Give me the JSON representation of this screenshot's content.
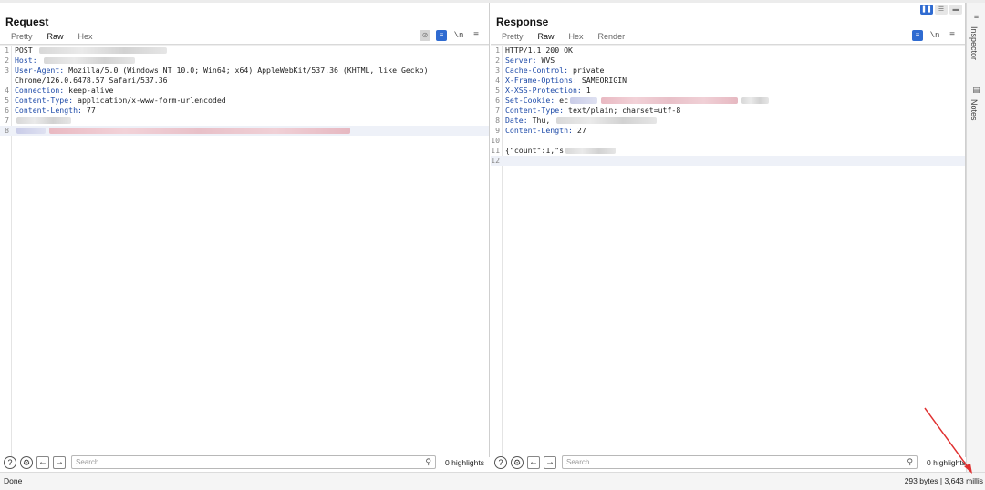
{
  "request": {
    "title": "Request",
    "tabs": [
      "Pretty",
      "Raw",
      "Hex"
    ],
    "active_tab": "Raw",
    "lines": [
      {
        "n": "1",
        "key": "",
        "val": "POST"
      },
      {
        "n": "2",
        "key": "Host:",
        "val": ""
      },
      {
        "n": "3",
        "key": "User-Agent:",
        "val": "Mozilla/5.0 (Windows NT 10.0; Win64; x64) AppleWebKit/537.36 (KHTML, like Gecko)"
      },
      {
        "n": "",
        "key": "",
        "val": "Chrome/126.0.6478.57 Safari/537.36"
      },
      {
        "n": "4",
        "key": "Connection:",
        "val": "keep-alive"
      },
      {
        "n": "5",
        "key": "Content-Type:",
        "val": "application/x-www-form-urlencoded"
      },
      {
        "n": "6",
        "key": "Content-Length:",
        "val": "77"
      },
      {
        "n": "7",
        "key": "",
        "val": ""
      },
      {
        "n": "8",
        "key": "",
        "val": ""
      }
    ],
    "search_placeholder": "Search",
    "highlights": "0 highlights"
  },
  "response": {
    "title": "Response",
    "tabs": [
      "Pretty",
      "Raw",
      "Hex",
      "Render"
    ],
    "active_tab": "Raw",
    "lines": [
      {
        "n": "1",
        "key": "",
        "val": "HTTP/1.1 200 OK"
      },
      {
        "n": "2",
        "key": "Server:",
        "val": "WVS"
      },
      {
        "n": "3",
        "key": "Cache-Control:",
        "val": "private"
      },
      {
        "n": "4",
        "key": "X-Frame-Options:",
        "val": "SAMEORIGIN"
      },
      {
        "n": "5",
        "key": "X-XSS-Protection:",
        "val": "1"
      },
      {
        "n": "6",
        "key": "Set-Cookie:",
        "val": "ec"
      },
      {
        "n": "7",
        "key": "Content-Type:",
        "val": "text/plain; charset=utf-8"
      },
      {
        "n": "8",
        "key": "Date:",
        "val": "Thu,"
      },
      {
        "n": "9",
        "key": "Content-Length:",
        "val": "27"
      },
      {
        "n": "10",
        "key": "",
        "val": ""
      },
      {
        "n": "11",
        "key": "",
        "val": "{\"count\":1,\"s"
      },
      {
        "n": "12",
        "key": "",
        "val": ""
      }
    ],
    "search_placeholder": "Search",
    "highlights": "0 highlights"
  },
  "sidebar": {
    "inspector": "Inspector",
    "notes": "Notes"
  },
  "status": {
    "left": "Done",
    "right": "293 bytes | 3,643 millis"
  },
  "icons": {
    "help": "help-icon",
    "settings": "gear-icon",
    "back": "arrow-left-icon",
    "forward": "arrow-right-icon",
    "search": "search-icon"
  },
  "colors": {
    "accent_tab": "#e8651e",
    "active_blue": "#2f6bd1",
    "header_key": "#1d4aa8",
    "annotation_arrow": "#e03030"
  }
}
